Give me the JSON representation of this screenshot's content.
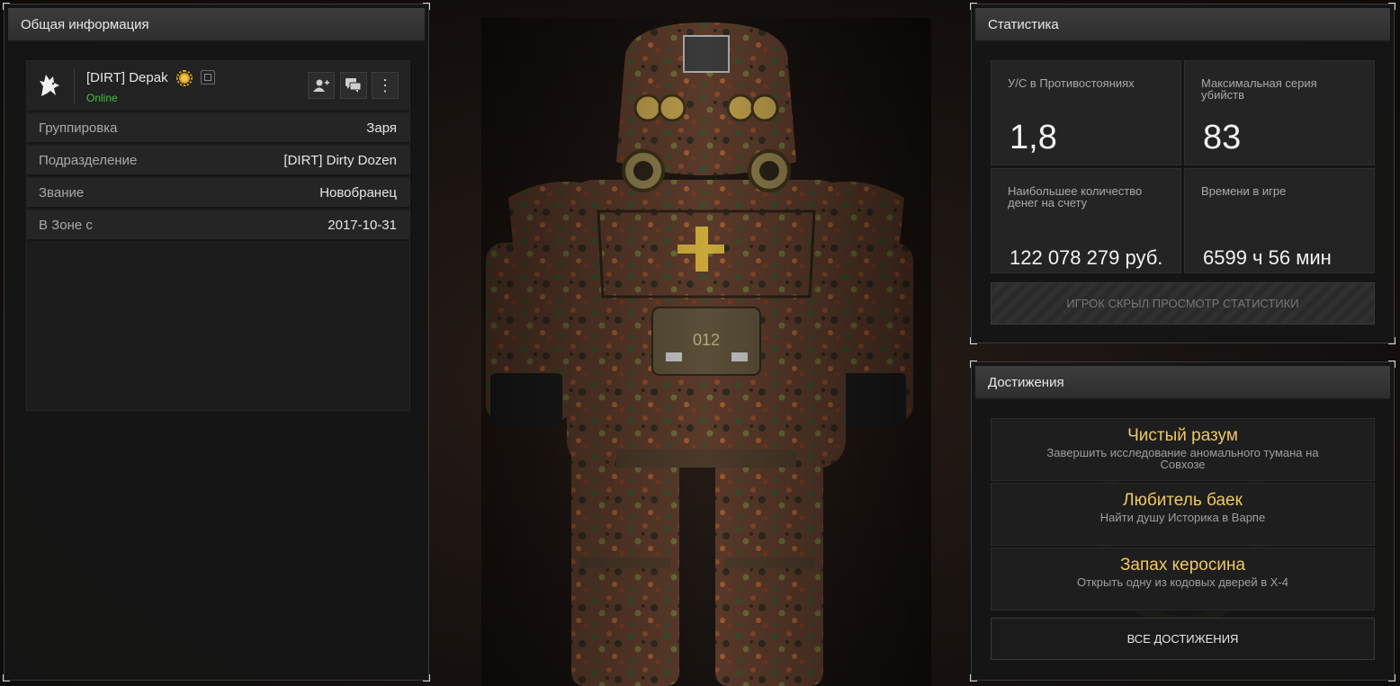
{
  "info_panel": {
    "title": "Общая информация",
    "player": {
      "name": "[DIRT] Depak",
      "status": "Online",
      "avatar_icon": "wolf-icon",
      "badge_icon": "gold-badge-icon",
      "copy_icon": "copy-icon"
    },
    "actions": [
      {
        "name": "add-friend",
        "icon": "user-plus-icon",
        "glyph": "👤"
      },
      {
        "name": "message",
        "icon": "chat-icon",
        "glyph": "💬"
      },
      {
        "name": "more",
        "icon": "more-vertical-icon",
        "glyph": "⋮"
      }
    ],
    "rows": [
      {
        "label": "Группировка",
        "value": "Заря"
      },
      {
        "label": "Подразделение",
        "value": "[DIRT] Dirty Dozen"
      },
      {
        "label": "Звание",
        "value": "Новобранец"
      },
      {
        "label": "В Зоне с",
        "value": "2017-10-31"
      }
    ]
  },
  "stats_panel": {
    "title": "Статистика",
    "cells": [
      {
        "label": "У/С в Противостояниях",
        "value": "1,8"
      },
      {
        "label": "Максимальная серия убийств",
        "value": "83"
      },
      {
        "label": "Наибольшее количество денег на счету",
        "value": "122 078 279 руб."
      },
      {
        "label": "Времени в игре",
        "value": "6599 ч 56 мин"
      }
    ],
    "hidden_notice": "ИГРОК СКРЫЛ ПРОСМОТР СТАТИСТИКИ"
  },
  "achievements_panel": {
    "title": "Достижения",
    "items": [
      {
        "title": "Чистый разум",
        "description": "Завершить исследование аномального тумана на Совхозе"
      },
      {
        "title": "Любитель баек",
        "description": "Найти душу Историка в Варпе"
      },
      {
        "title": "Запах керосина",
        "description": "Открыть одну из кодовых дверей в Х-4"
      }
    ],
    "all_button": "ВСЕ ДОСТИЖЕНИЯ"
  },
  "character": {
    "chest_number": "012"
  },
  "colors": {
    "accent_gold": "#f0c861",
    "online_green": "#3ec43e"
  }
}
